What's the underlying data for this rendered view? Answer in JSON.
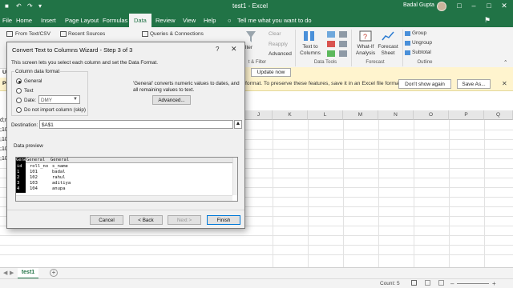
{
  "titlebar": {
    "document": "test1 - Excel",
    "user": "Badal Gupta"
  },
  "tabs": [
    {
      "label": "File"
    },
    {
      "label": "Home"
    },
    {
      "label": "Insert"
    },
    {
      "label": "Page Layout"
    },
    {
      "label": "Formulas"
    },
    {
      "label": "Data"
    },
    {
      "label": "Review"
    },
    {
      "label": "View"
    },
    {
      "label": "Help"
    }
  ],
  "active_tab": "Data",
  "tell_me": "Tell me what you want to do",
  "ribbon": {
    "from_text_csv": "From Text/CSV",
    "recent_sources": "Recent Sources",
    "queries_connections": "Queries & Connections",
    "clear": "Clear",
    "reapply": "Reapply",
    "advanced": "Advanced",
    "filter": "lter",
    "sort_filter_group": "t & Filter",
    "text_to_columns": "Text to Columns",
    "data_tools_group": "Data Tools",
    "what_if": "What-If Analysis",
    "forecast_sheet": "Forecast Sheet",
    "forecast_group": "Forecast",
    "group": "Group",
    "ungroup": "Ungroup",
    "subtotal": "Subtotal",
    "outline_group": "Outline"
  },
  "update_bar": {
    "button": "Update now"
  },
  "info_bar": {
    "prefix": "UF",
    "prefix2": "PC",
    "message": "format. To preserve these features, save it in an Excel file format.",
    "dont_show": "Don't show again",
    "save_as": "Save As..."
  },
  "grid": {
    "columns": [
      "J",
      "K",
      "L",
      "M",
      "N",
      "O",
      "P",
      "Q"
    ],
    "row_fragments": [
      "d;ro",
      ";10",
      ";10",
      ";10",
      ";10"
    ]
  },
  "sheets": [
    {
      "name": "test1"
    }
  ],
  "status": {
    "count": "Count: 5"
  },
  "dialog": {
    "title": "Convert Text to Columns Wizard - Step 3 of 3",
    "help": "?",
    "intro": "This screen lets you select each column and set the Data Format.",
    "column_format_legend": "Column data format",
    "options": [
      {
        "label": "General",
        "selected": true
      },
      {
        "label": "Text",
        "selected": false
      },
      {
        "label": "Date:",
        "selected": false
      },
      {
        "label": "Do not import column (skip)",
        "selected": false
      }
    ],
    "date_format": "DMY",
    "general_note": "'General' converts numeric values to dates, and all remaining values to text.",
    "advanced_button": "Advanced...",
    "destination_label": "Destination:",
    "destination_value": "$A$1",
    "preview_legend": "Data preview",
    "preview": {
      "headers": [
        "General",
        "General",
        "General"
      ],
      "col1": [
        "id",
        "1",
        "2",
        "3",
        "4"
      ],
      "col2": [
        "roll_no",
        "101",
        "102",
        "103",
        "104"
      ],
      "col3": [
        "s_name",
        "badal",
        "rahul",
        "aditiya",
        "anupa"
      ]
    },
    "buttons": {
      "cancel": "Cancel",
      "back": "< Back",
      "next": "Next >",
      "finish": "Finish"
    }
  }
}
